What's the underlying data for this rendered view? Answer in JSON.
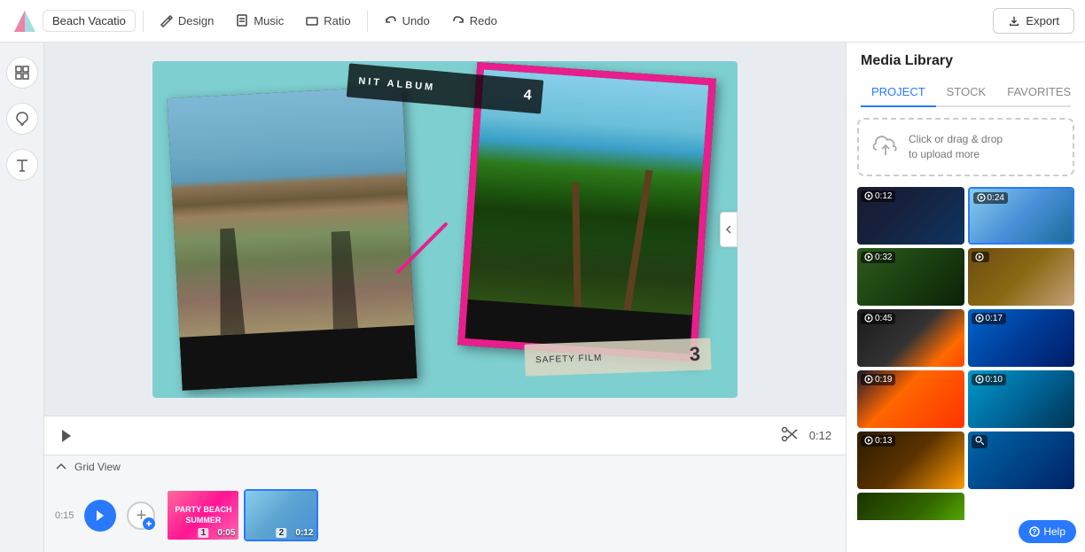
{
  "topbar": {
    "logo_alt": "App Logo",
    "project_name": "Beach Vacatio",
    "design_label": "Design",
    "music_label": "Music",
    "ratio_label": "Ratio",
    "undo_label": "Undo",
    "redo_label": "Redo",
    "export_label": "Export"
  },
  "left_tools": {
    "grid_label": "Grid",
    "color_label": "Color",
    "text_label": "Text"
  },
  "playback": {
    "time": "0:12"
  },
  "timeline": {
    "label": "Grid View",
    "time_offset": "0:15",
    "clip1_time": "0:05",
    "clip1_num": "1",
    "clip1_text": "PARTY BEACH SUMMER",
    "clip2_time": "0:12",
    "clip2_num": "2"
  },
  "right_panel": {
    "title": "Media Library",
    "tab_project": "PROJECT",
    "tab_stock": "STOCK",
    "tab_favorites": "FAVORITES",
    "upload_text_line1": "Click or drag & drop",
    "upload_text_line2": "to upload more",
    "media_items": [
      {
        "id": 1,
        "thumb_class": "thumb-1",
        "duration": "0:12",
        "type": "play"
      },
      {
        "id": 2,
        "thumb_class": "thumb-2",
        "duration": "0:24",
        "type": "play"
      },
      {
        "id": 3,
        "thumb_class": "thumb-3",
        "duration": "0:32",
        "type": "play"
      },
      {
        "id": 4,
        "thumb_class": "thumb-4",
        "duration": "",
        "type": "play"
      },
      {
        "id": 5,
        "thumb_class": "thumb-5",
        "duration": "0:45",
        "type": "play"
      },
      {
        "id": 6,
        "thumb_class": "thumb-6",
        "duration": "0:17",
        "type": "play"
      },
      {
        "id": 7,
        "thumb_class": "thumb-7",
        "duration": "0:19",
        "type": "play"
      },
      {
        "id": 8,
        "thumb_class": "thumb-8",
        "duration": "0:10",
        "type": "play"
      },
      {
        "id": 9,
        "thumb_class": "thumb-9",
        "duration": "0:13",
        "type": "play"
      },
      {
        "id": 10,
        "thumb_class": "thumb-10",
        "duration": "",
        "type": "zoom"
      },
      {
        "id": 11,
        "thumb_class": "thumb-11",
        "duration": "",
        "type": "none"
      }
    ],
    "help_label": "Help"
  },
  "colors": {
    "accent_blue": "#2979ff",
    "teal_bg": "#7ecfd0",
    "pink_border": "#e91e8c"
  }
}
